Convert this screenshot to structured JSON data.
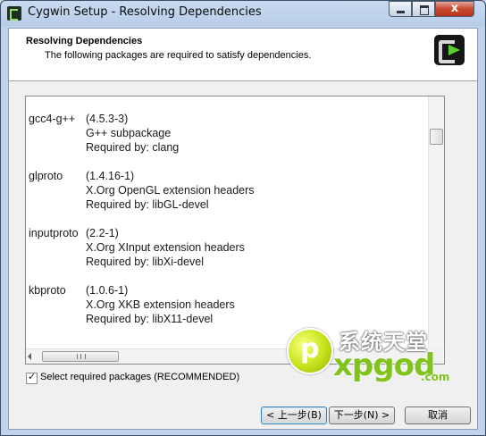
{
  "window": {
    "title": "Cygwin Setup - Resolving Dependencies",
    "close_glyph": "x"
  },
  "header": {
    "title": "Resolving Dependencies",
    "subtitle": "The following packages are required to satisfy dependencies."
  },
  "packages": [
    {
      "name": "gcc4-g++",
      "version": "(4.5.3-3)",
      "description": "G++ subpackage",
      "required_by": "Required by: clang"
    },
    {
      "name": "glproto",
      "version": "(1.4.16-1)",
      "description": "X.Org OpenGL extension headers",
      "required_by": "Required by: libGL-devel"
    },
    {
      "name": "inputproto",
      "version": "(2.2-1)",
      "description": "X.Org XInput extension headers",
      "required_by": "Required by: libXi-devel"
    },
    {
      "name": "kbproto",
      "version": "(1.0.6-1)",
      "description": "X.Org XKB extension headers",
      "required_by": "Required by: libX11-devel"
    }
  ],
  "checkbox": {
    "label": "Select required packages (RECOMMENDED)",
    "checked": true,
    "mark": "✓"
  },
  "buttons": {
    "back": "< 上一步(B)",
    "next": "下一步(N) >",
    "cancel": "取消"
  },
  "watermark": {
    "chinese": "系统天堂",
    "brand": "xpgod",
    "domain": ".com"
  },
  "icons": [
    "cygwin-app-icon",
    "minimize-icon",
    "maximize-icon",
    "close-icon",
    "cygwin-logo-icon",
    "scroll-left-icon"
  ]
}
